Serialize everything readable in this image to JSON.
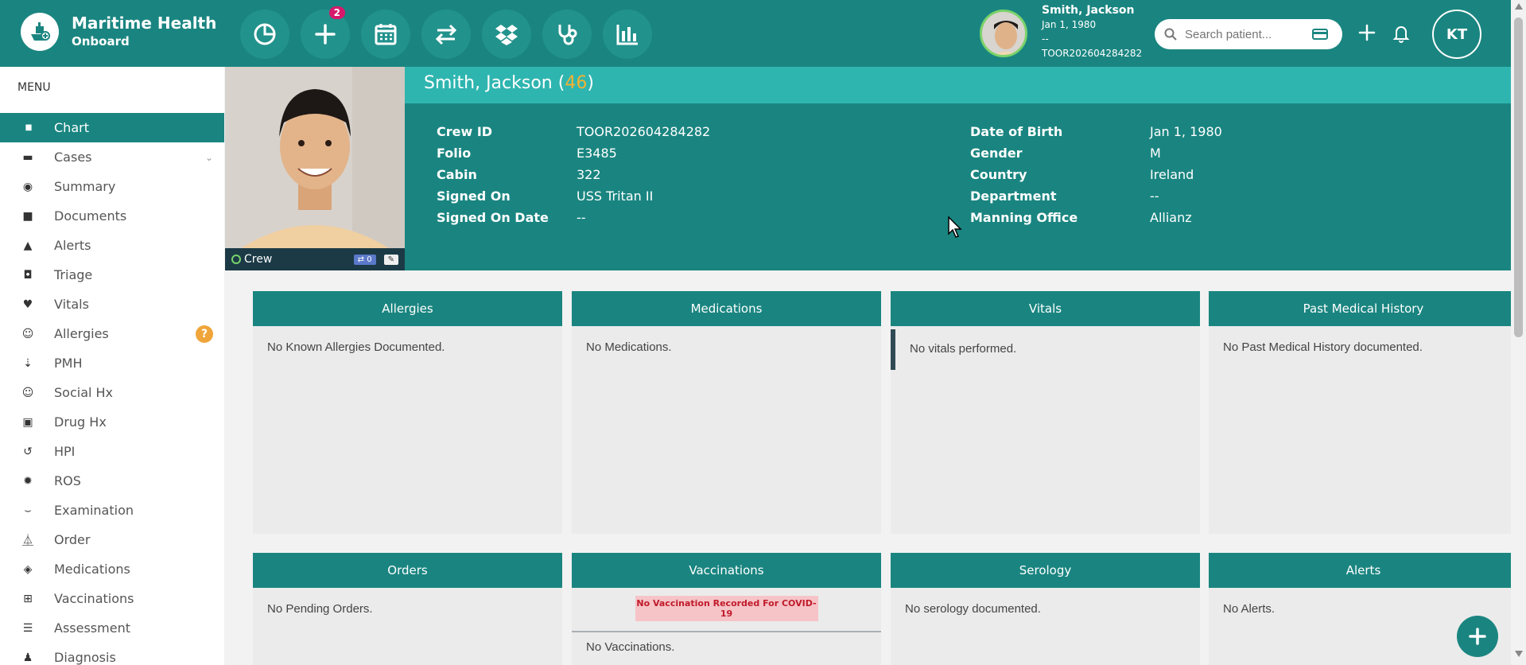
{
  "brand": {
    "title": "Maritime Health",
    "subtitle": "Onboard"
  },
  "toolbar": {
    "add_badge": "2"
  },
  "patient": {
    "name": "Smith, Jackson",
    "dob": "Jan 1, 1980",
    "placeholder": "--",
    "id": "TOOR202604284282",
    "age": "46"
  },
  "search": {
    "placeholder": "Search patient..."
  },
  "user": {
    "initials": "KT"
  },
  "sidebar": {
    "title": "MENU",
    "items": [
      {
        "label": "Chart",
        "icon": "bar-chart-icon"
      },
      {
        "label": "Cases",
        "icon": "archive-icon"
      },
      {
        "label": "Summary",
        "icon": "eye-icon"
      },
      {
        "label": "Documents",
        "icon": "folder-icon"
      },
      {
        "label": "Alerts",
        "icon": "warning-icon"
      },
      {
        "label": "Triage",
        "icon": "inbox-icon"
      },
      {
        "label": "Vitals",
        "icon": "heart-icon"
      },
      {
        "label": "Allergies",
        "icon": "smiley-icon"
      },
      {
        "label": "PMH",
        "icon": "sort-icon"
      },
      {
        "label": "Social Hx",
        "icon": "smiley-icon"
      },
      {
        "label": "Drug Hx",
        "icon": "medkit-icon"
      },
      {
        "label": "HPI",
        "icon": "history-icon"
      },
      {
        "label": "ROS",
        "icon": "gear-icon"
      },
      {
        "label": "Examination",
        "icon": "stethoscope-icon"
      },
      {
        "label": "Order",
        "icon": "flask-icon"
      },
      {
        "label": "Medications",
        "icon": "pill-icon"
      },
      {
        "label": "Vaccinations",
        "icon": "plus-square-icon"
      },
      {
        "label": "Assessment",
        "icon": "list-icon"
      },
      {
        "label": "Diagnosis",
        "icon": "doctor-icon"
      }
    ],
    "allergies_badge": "?"
  },
  "photo": {
    "status": "Crew",
    "count": "0"
  },
  "details": {
    "left": [
      {
        "key": "Crew ID",
        "value": "TOOR202604284282"
      },
      {
        "key": "Folio",
        "value": "E3485"
      },
      {
        "key": "Cabin",
        "value": "322"
      },
      {
        "key": "Signed On",
        "value": "USS Tritan II"
      },
      {
        "key": "Signed On Date",
        "value": "--"
      }
    ],
    "right": [
      {
        "key": "Date of Birth",
        "value": "Jan 1, 1980"
      },
      {
        "key": "Gender",
        "value": "M"
      },
      {
        "key": "Country",
        "value": "Ireland"
      },
      {
        "key": "Department",
        "value": "--"
      },
      {
        "key": "Manning Office",
        "value": "Allianz"
      }
    ]
  },
  "cards": {
    "allergies": {
      "title": "Allergies",
      "body": "No Known Allergies Documented."
    },
    "medications": {
      "title": "Medications",
      "body": "No Medications."
    },
    "vitals": {
      "title": "Vitals",
      "body": "No vitals performed."
    },
    "pmh": {
      "title": "Past Medical History",
      "body": "No Past Medical History documented."
    },
    "orders": {
      "title": "Orders",
      "body": "No Pending Orders."
    },
    "vaccinations": {
      "title": "Vaccinations",
      "warning": "No Vaccination Recorded For COVID-19",
      "body": "No Vaccinations."
    },
    "serology": {
      "title": "Serology",
      "body": "No serology documented."
    },
    "alerts": {
      "title": "Alerts",
      "body": "No Alerts."
    }
  },
  "colors": {
    "primary": "#1a8580",
    "accent": "#2fb5b0",
    "age": "#f2b233",
    "badge": "#d6196b"
  }
}
